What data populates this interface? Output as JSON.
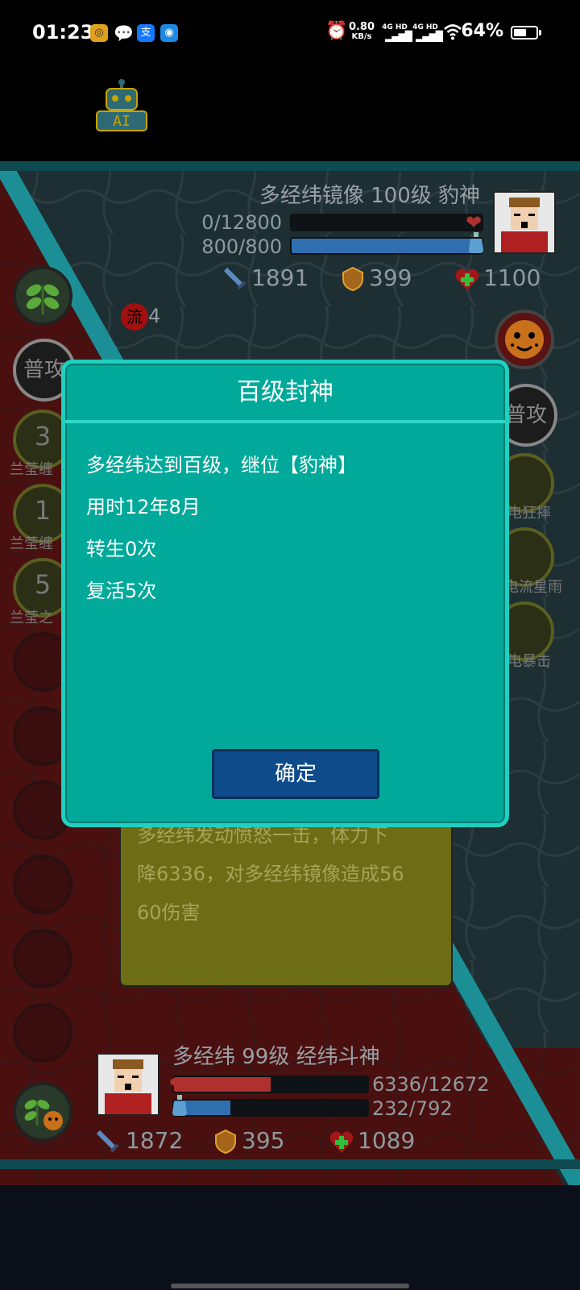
{
  "status_bar": {
    "time": "01:23",
    "net_speed_value": "0.80",
    "net_speed_unit": "KB/s",
    "signal1": "4G HD",
    "signal2": "4G HD",
    "battery": "64%",
    "battery_level": 0.64,
    "app_icons": [
      "notes-app-icon",
      "chat-app-icon",
      "alipay-app-icon",
      "messenger-app-icon"
    ]
  },
  "ai_button": {
    "label": "AI"
  },
  "enemy": {
    "title": "多经纬镜像 100级 豹神",
    "hp_text": "0/12800",
    "hp_fraction": 0,
    "mp_text": "800/800",
    "mp_fraction": 1,
    "attack": "1891",
    "defense": "399",
    "health": "1100",
    "status_badge": "流",
    "status_count": "4",
    "normal_attack_label": "普攻",
    "skills": [
      {
        "label": "电狂摔"
      },
      {
        "label": "电流星雨"
      },
      {
        "label": "电暴击"
      }
    ]
  },
  "player": {
    "title": "多经纬 99级 经纬斗神",
    "hp_text": "6336/12672",
    "hp_fraction": 0.5,
    "mp_text": "232/792",
    "mp_fraction": 0.293,
    "attack": "1872",
    "defense": "395",
    "health": "1089",
    "normal_attack_label": "普攻",
    "skills": [
      {
        "count": "3",
        "label": "兰莹缠"
      },
      {
        "count": "1",
        "label": "兰莹缠"
      },
      {
        "count": "5",
        "label": "兰莹之"
      }
    ]
  },
  "battle_log": {
    "lines": [
      "多经纬发动愤怒一击，体力下",
      "降6336，对多经纬镜像造成56",
      "60伤害"
    ]
  },
  "dialog": {
    "title": "百级封神",
    "lines": [
      "多经纬达到百级，继位【豹神】",
      "用时12年8月",
      "转生0次",
      "复活5次"
    ],
    "confirm_label": "确定"
  },
  "colors": {
    "dialog_bg": "#00a99a",
    "dialog_border": "#1fd0c0",
    "confirm_bg": "#0d4b8a",
    "hp_red": "#b03030",
    "mp_blue": "#2f6fb0",
    "left_panel_red": "#5a1212",
    "diagonal_teal": "#1c8f96"
  }
}
